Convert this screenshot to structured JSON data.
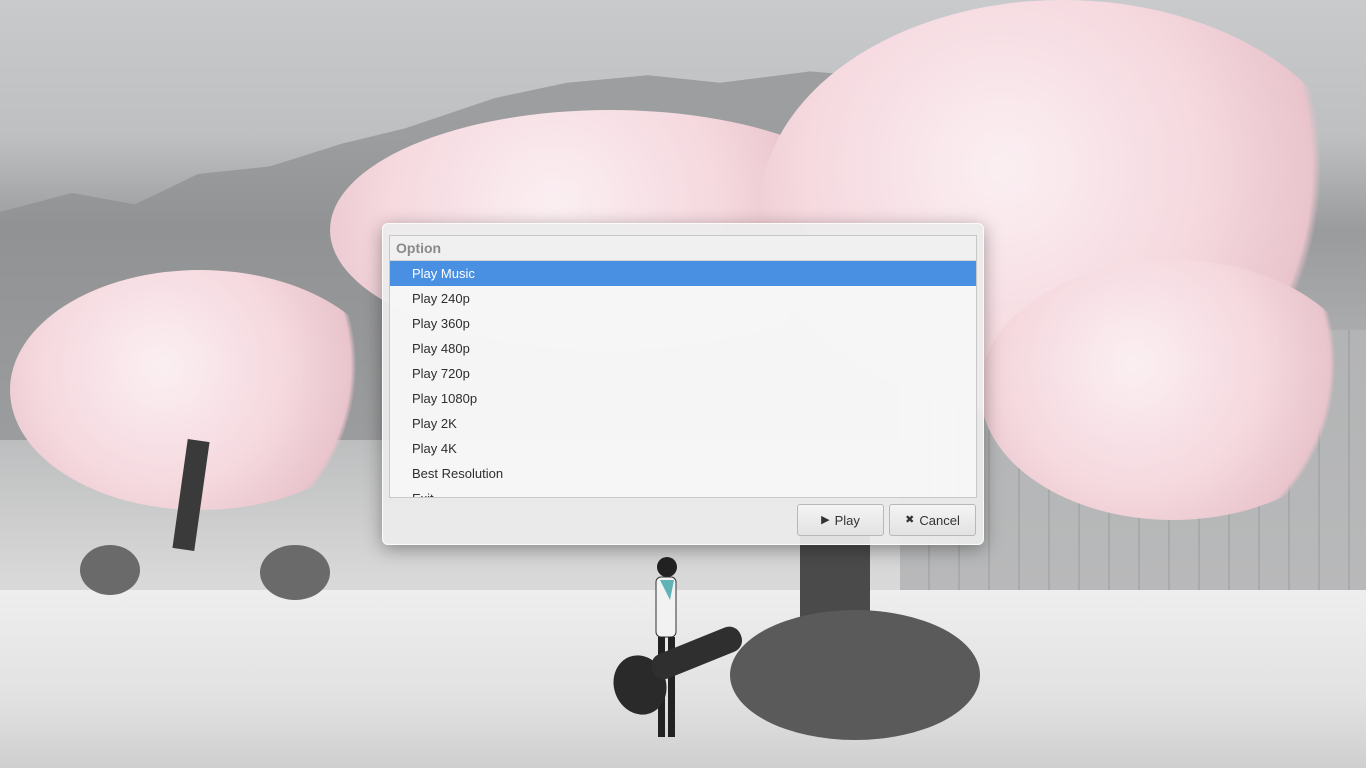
{
  "dialog": {
    "header": "Option",
    "items": [
      {
        "label": "Play Music",
        "selected": true
      },
      {
        "label": "Play 240p",
        "selected": false
      },
      {
        "label": "Play 360p",
        "selected": false
      },
      {
        "label": "Play 480p",
        "selected": false
      },
      {
        "label": "Play 720p",
        "selected": false
      },
      {
        "label": "Play 1080p",
        "selected": false
      },
      {
        "label": "Play 2K",
        "selected": false
      },
      {
        "label": "Play 4K",
        "selected": false
      },
      {
        "label": "Best Resolution",
        "selected": false
      },
      {
        "label": "Exit",
        "selected": false
      }
    ],
    "buttons": {
      "play_label": "Play",
      "play_icon": "play-icon",
      "cancel_label": "Cancel",
      "cancel_icon": "close-icon"
    }
  },
  "colors": {
    "selection": "#4a90e2",
    "dialog_background": "#ececec"
  },
  "wallpaper": "cherry-blossom-wallpaper"
}
